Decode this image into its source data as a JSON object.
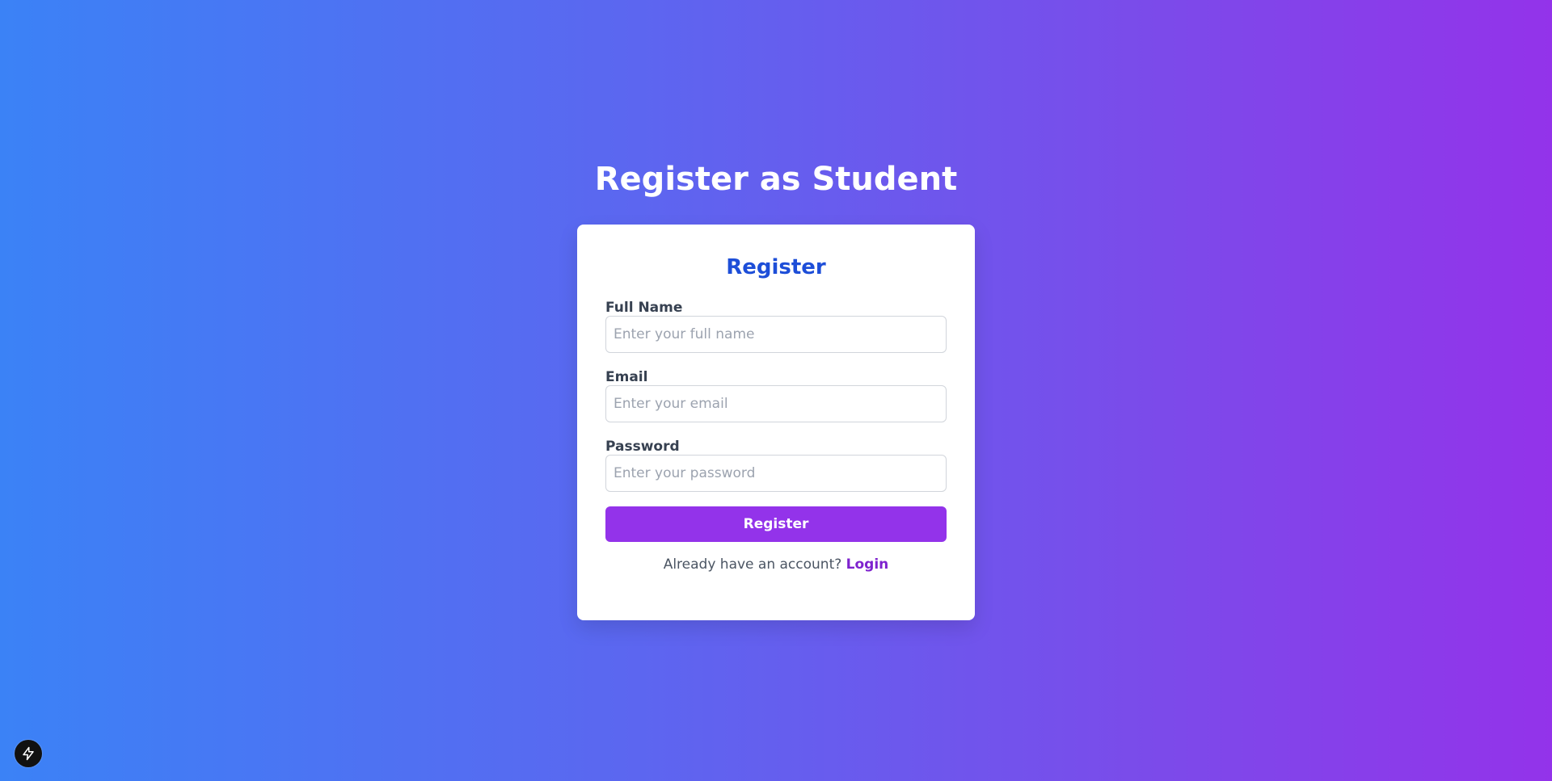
{
  "page": {
    "heading": "Register as Student"
  },
  "form": {
    "title": "Register",
    "fields": [
      {
        "label": "Full Name",
        "placeholder": "Enter your full name",
        "value": ""
      },
      {
        "label": "Email",
        "placeholder": "Enter your email",
        "value": ""
      },
      {
        "label": "Password",
        "placeholder": "Enter your password",
        "value": ""
      }
    ],
    "submit_label": "Register",
    "footer_text": "Already have an account?",
    "login_link_label": "Login"
  },
  "dev_badge": {
    "icon": "lightning-bolt-icon"
  },
  "colors": {
    "gradient_start": "#3b82f6",
    "gradient_end": "#9333ea",
    "title_blue": "#1d4ed8",
    "button_purple": "#9333ea",
    "link_purple": "#7e22ce"
  }
}
